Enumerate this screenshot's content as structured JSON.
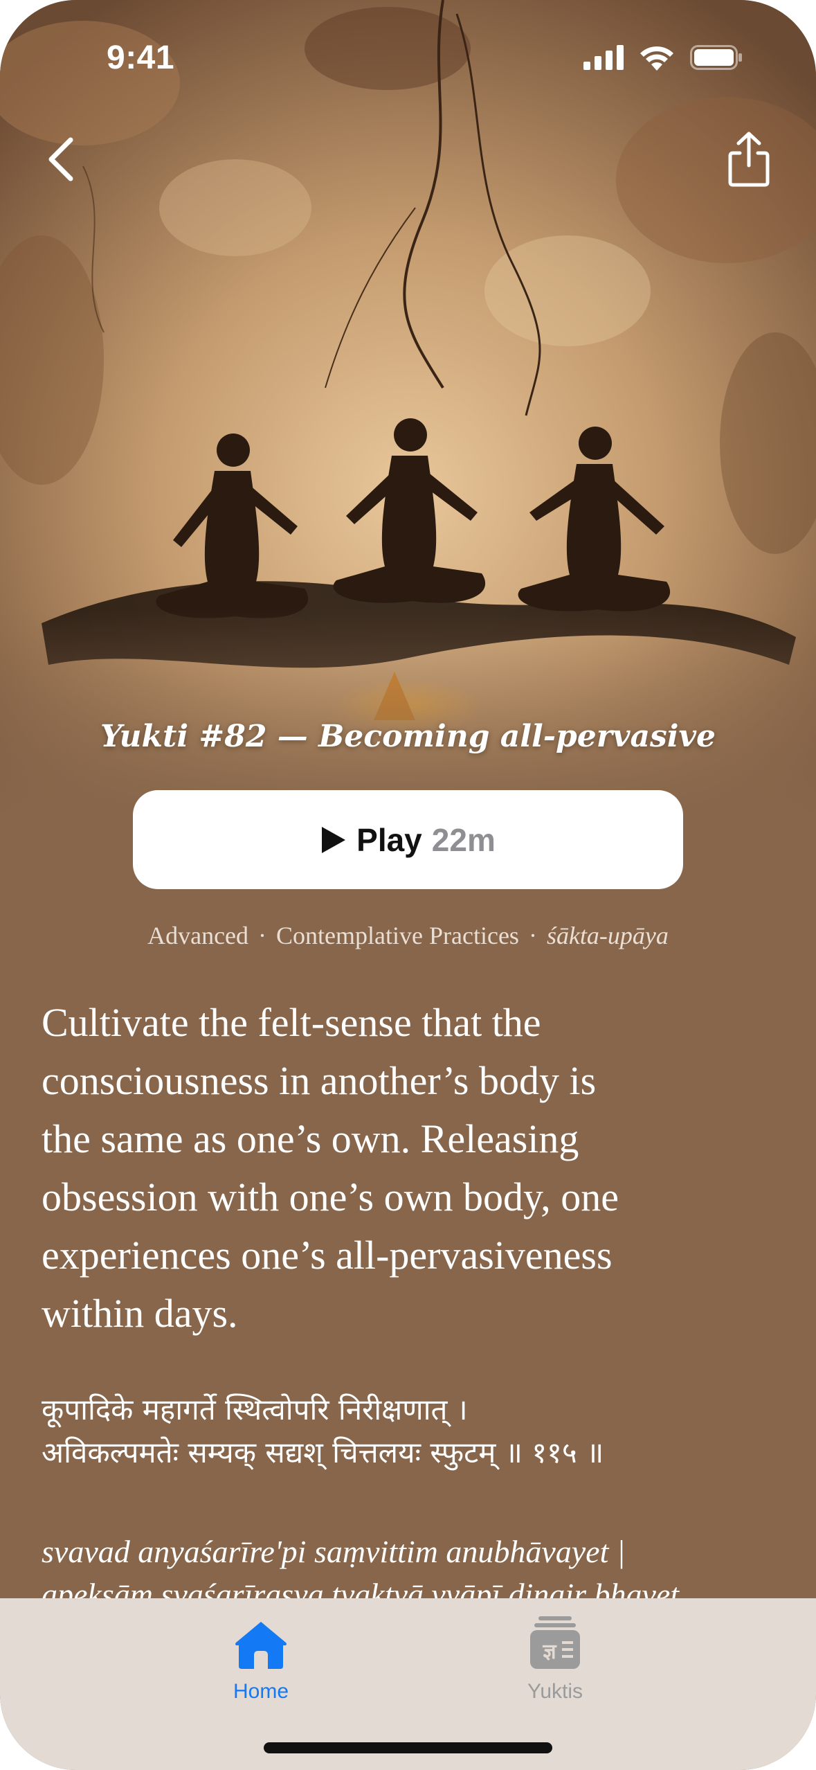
{
  "status_bar": {
    "time": "9:41"
  },
  "hero": {
    "title": "Yukti #82 — Becoming all-pervasive"
  },
  "play": {
    "label": "Play",
    "duration": "22m"
  },
  "meta": {
    "level": "Advanced",
    "category": "Contemplative Practices",
    "upaya": "śākta-upāya"
  },
  "description": [
    "Cultivate the felt-sense that the",
    "consciousness in another’s body is",
    "the same as one’s own. Releasing",
    "obsession with one’s own body, one",
    "experiences one’s all-pervasiveness",
    "within days."
  ],
  "sanskrit": [
    "कूपादिके महागर्ते स्थित्वोपरि निरीक्षणात् ।",
    "अविकल्पमतेः सम्यक् सद्यश् चित्तलयः स्फुटम् ॥ ११५ ॥"
  ],
  "transliteration": [
    "svavad anyaśarīre'pi saṃvittim anubhāvayet |",
    "apekṣāṃ svaśarīrasya tyaktvā vyāpī dinair bhavet"
  ],
  "tabs": [
    {
      "label": "Home",
      "active": true,
      "icon": "house-icon"
    },
    {
      "label": "Yuktis",
      "active": false,
      "icon": "book-stack-icon",
      "glyph": "ज्ञ"
    }
  ],
  "colors": {
    "background": "#87664b",
    "accent": "#1479f5",
    "tabbar": "#e2dad3"
  }
}
